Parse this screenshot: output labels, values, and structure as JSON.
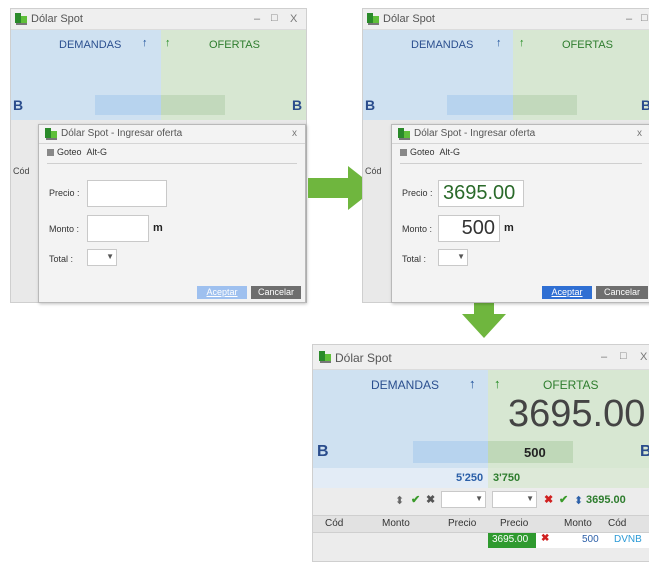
{
  "panel1": {
    "title": "Dólar Spot",
    "controls": {
      "min": "–",
      "max": "□",
      "close": "X"
    },
    "demandas": "DEMANDAS",
    "ofertas": "OFERTAS",
    "b_left": "B",
    "b_right": "B",
    "side_label": "Cód",
    "dialog": {
      "title": "Dólar Spot - Ingresar oferta",
      "close": "x",
      "goteo": "Goteo",
      "goteo_shortcut": "Alt-G",
      "precio_label": "Precio :",
      "precio_value": "",
      "monto_label": "Monto :",
      "monto_value": "",
      "monto_unit": "m",
      "total_label": "Total :",
      "accept": "Aceptar",
      "cancel": "Cancelar"
    }
  },
  "panel2": {
    "title": "Dólar Spot",
    "demandas": "DEMANDAS",
    "ofertas": "OFERTAS",
    "b_left": "B",
    "b_right": "B",
    "side_label": "Cód",
    "dialog": {
      "title": "Dólar Spot - Ingresar oferta",
      "close": "x",
      "goteo": "Goteo",
      "goteo_shortcut": "Alt-G",
      "precio_label": "Precio :",
      "precio_value": "3695.00",
      "monto_label": "Monto :",
      "monto_value": "500",
      "monto_unit": "m",
      "total_label": "Total :",
      "accept": "Aceptar",
      "cancel": "Cancelar"
    }
  },
  "panel3": {
    "title": "Dólar Spot",
    "controls": {
      "min": "–",
      "max": "□",
      "close": "X"
    },
    "demandas": "DEMANDAS",
    "ofertas": "OFERTAS",
    "big_price": "3695.00",
    "b_left": "B",
    "b_right": "B",
    "offer_amount": "500",
    "dem_total": "5'250",
    "of_total": "3'750",
    "toolbar_price": "3695.00",
    "left_columns": [
      "Cód",
      "Monto",
      "Precio"
    ],
    "right_columns": [
      "Precio",
      "Monto",
      "Cód"
    ],
    "row": {
      "precio": "3695.00",
      "monto": "500",
      "cod": "DVNB"
    }
  },
  "colors": {
    "demandas_bg": "#cfe1f1",
    "ofertas_bg": "#d7e7d2",
    "arrow": "#6fb63e",
    "row_highlight": "#2f9a2f",
    "accept_active": "#2f6fd3",
    "accept_disabled": "#9ec0ef"
  }
}
